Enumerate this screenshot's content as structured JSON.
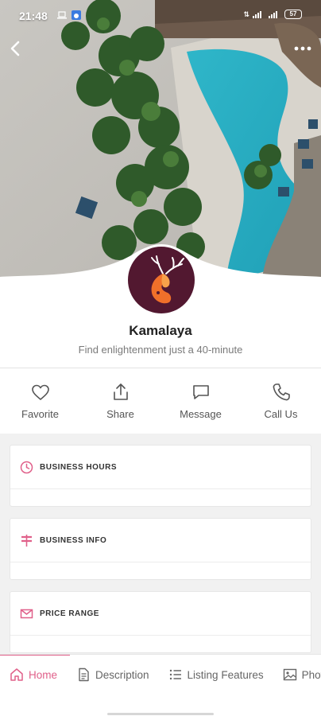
{
  "status_bar": {
    "time": "21:48",
    "battery": "57"
  },
  "profile": {
    "name": "Kamalaya",
    "tagline": "Find enlightenment just a 40-minute"
  },
  "actions": [
    {
      "label": "Favorite",
      "icon": "heart-icon"
    },
    {
      "label": "Share",
      "icon": "share-icon"
    },
    {
      "label": "Message",
      "icon": "message-icon"
    },
    {
      "label": "Call Us",
      "icon": "phone-icon"
    }
  ],
  "sections": [
    {
      "label": "BUSINESS HOURS",
      "icon": "clock-icon"
    },
    {
      "label": "BUSINESS INFO",
      "icon": "signpost-icon"
    },
    {
      "label": "PRICE RANGE",
      "icon": "envelope-icon"
    }
  ],
  "tabs": [
    {
      "label": "Home",
      "icon": "home-icon",
      "active": true
    },
    {
      "label": "Description",
      "icon": "document-icon"
    },
    {
      "label": "Listing Features",
      "icon": "list-icon"
    },
    {
      "label": "Photos",
      "icon": "image-icon"
    }
  ],
  "colors": {
    "accent": "#e0608a",
    "avatar_bg": "#521830",
    "logo_orange": "#f0702a"
  }
}
